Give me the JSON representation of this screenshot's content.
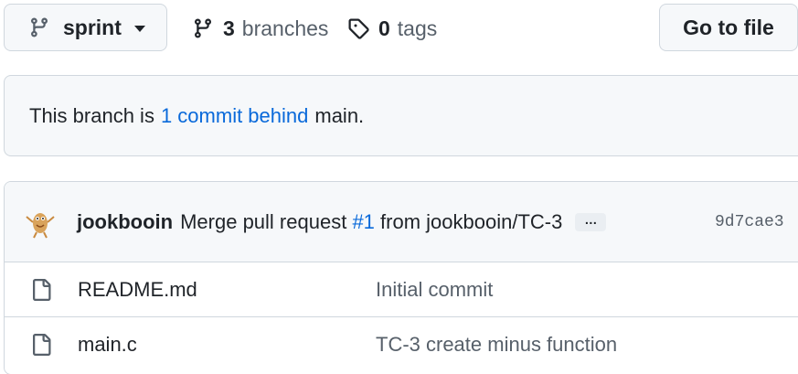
{
  "branch_selector": {
    "name": "sprint",
    "icon": "git-branch-icon"
  },
  "branches": {
    "count": "3",
    "label": "branches",
    "icon": "git-branch-icon"
  },
  "tags": {
    "count": "0",
    "label": "tags",
    "icon": "tag-icon"
  },
  "go_to_file": "Go to file",
  "status": {
    "prefix": "This branch is",
    "link": "1 commit behind",
    "suffix": "main."
  },
  "latest_commit": {
    "author": "jookbooin",
    "message_prefix": "Merge pull request",
    "pr_link": "#1",
    "message_suffix": "from jookbooin/TC-3",
    "ellipsis": "…",
    "sha": "9d7cae3"
  },
  "files": [
    {
      "name": "README.md",
      "commit": "Initial commit",
      "icon": "file-icon"
    },
    {
      "name": "main.c",
      "commit": "TC-3 create minus function",
      "icon": "file-icon"
    }
  ],
  "colors": {
    "link": "#0969da",
    "muted": "#57606a",
    "border": "#d0d7de",
    "subtle_bg": "#f6f8fa"
  }
}
